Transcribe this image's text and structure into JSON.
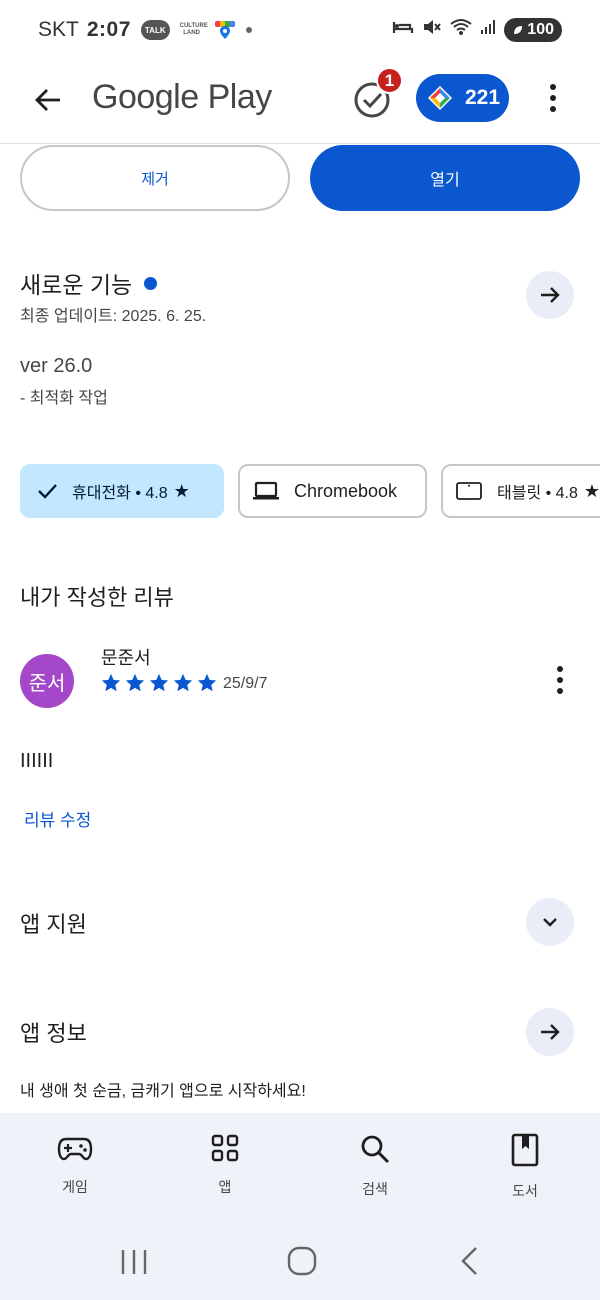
{
  "status_bar": {
    "carrier": "SKT",
    "time": "2:07",
    "talk_label": "TALK",
    "culture_label": "CULTURE LAND",
    "battery": "100"
  },
  "app_bar": {
    "title": "Google Play",
    "notification_count": "1",
    "points": "221"
  },
  "actions": {
    "remove_label": "제거",
    "open_label": "열기"
  },
  "whats_new": {
    "title": "새로운 기능",
    "last_updated": "최종 업데이트: 2025. 6. 25.",
    "version": "ver 26.0",
    "notes": "- 최적화 작업"
  },
  "device_chips": [
    {
      "label": "휴대전화 • 4.8",
      "icon": "check-icon",
      "selected": true
    },
    {
      "label": "Chromebook",
      "icon": "laptop-icon",
      "selected": false
    },
    {
      "label": "태블릿 • 4.8",
      "icon": "tablet-icon",
      "selected": false
    }
  ],
  "my_review": {
    "title": "내가 작성한 리뷰",
    "avatar_text": "준서",
    "reviewer_name": "문준서",
    "rating": 5,
    "date": "25/9/7",
    "text": "IIIIII",
    "edit_label": "리뷰 수정"
  },
  "app_support": {
    "title": "앱 지원"
  },
  "app_info": {
    "title": "앱 정보",
    "description": "내 생애 첫 순금, 금캐기 앱으로 시작하세요!"
  },
  "bottom_nav": [
    {
      "label": "게임",
      "icon": "gamepad-icon"
    },
    {
      "label": "앱",
      "icon": "apps-grid-icon"
    },
    {
      "label": "검색",
      "icon": "search-icon"
    },
    {
      "label": "도서",
      "icon": "book-icon"
    }
  ],
  "colors": {
    "accent": "#0b57d0",
    "chip_selected": "#c2e7ff",
    "avatar": "#a447c8",
    "badge": "#c5221f",
    "nav_bg": "#f0f2f9"
  }
}
